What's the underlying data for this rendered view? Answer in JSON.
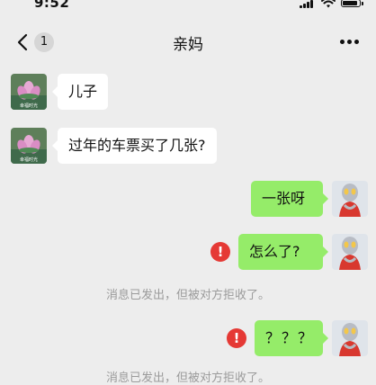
{
  "status_bar": {
    "time": "9:52"
  },
  "nav": {
    "back_badge": "1",
    "title": "亲妈"
  },
  "avatars": {
    "mom_caption": "幸福时光"
  },
  "messages": [
    {
      "side": "in",
      "text": "儿子"
    },
    {
      "side": "in",
      "text": "过年的车票买了几张?"
    },
    {
      "side": "out",
      "text": "一张呀",
      "failed": false
    },
    {
      "side": "out",
      "text": "怎么了?",
      "failed": true
    },
    {
      "side": "notice",
      "text": "消息已发出，但被对方拒收了。"
    },
    {
      "side": "out",
      "text": "？？？",
      "failed": true
    },
    {
      "side": "notice",
      "text": "消息已发出，但被对方拒收了。"
    }
  ],
  "colors": {
    "bg": "#ededed",
    "out_bubble": "#95ec69",
    "in_bubble": "#ffffff",
    "fail": "#e53935"
  },
  "icons": [
    "back-chevron-icon",
    "more-dots-icon",
    "signal-icon",
    "wifi-icon",
    "battery-icon",
    "fail-exclamation-icon"
  ]
}
